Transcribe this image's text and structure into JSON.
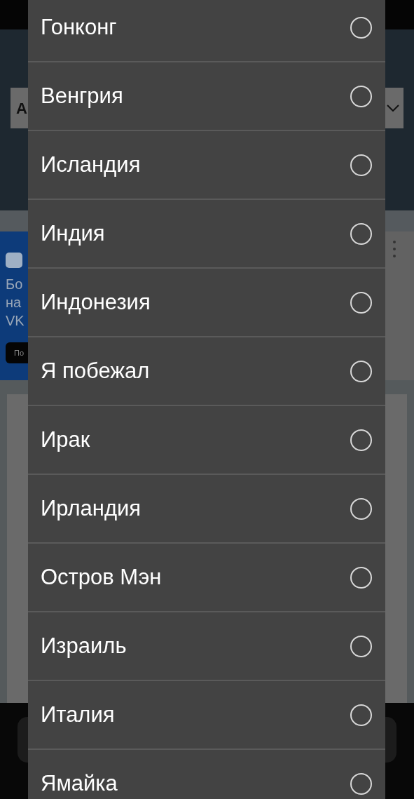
{
  "page": {
    "select_fragment": "А",
    "ad": {
      "lines": [
        "Бо",
        "на",
        "VK"
      ],
      "button": "По"
    }
  },
  "dropdown": {
    "options": [
      {
        "label": "Гонконг",
        "selected": false
      },
      {
        "label": "Венгрия",
        "selected": false
      },
      {
        "label": "Исландия",
        "selected": false
      },
      {
        "label": "Индия",
        "selected": false
      },
      {
        "label": "Индонезия",
        "selected": false
      },
      {
        "label": "Я побежал",
        "selected": false
      },
      {
        "label": "Ирак",
        "selected": false
      },
      {
        "label": "Ирландия",
        "selected": false
      },
      {
        "label": "Остров Мэн",
        "selected": false
      },
      {
        "label": "Израиль",
        "selected": false
      },
      {
        "label": "Италия",
        "selected": false
      },
      {
        "label": "Ямайка",
        "selected": false
      }
    ]
  }
}
